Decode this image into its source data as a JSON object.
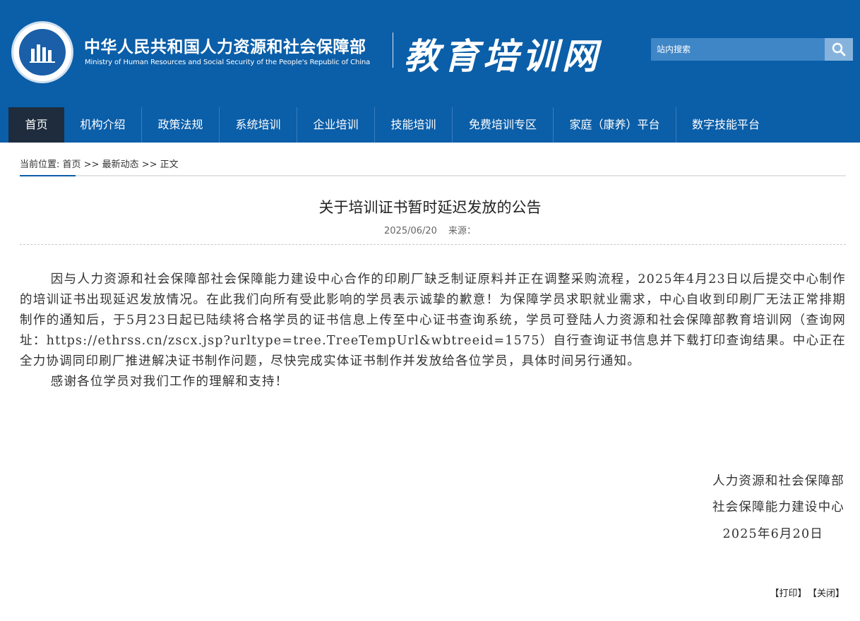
{
  "header": {
    "ministry_cn": "中华人民共和国人力资源和社会保障部",
    "ministry_en": "Ministry of Human Resources and Social Security of the People's Republic of China",
    "site_title": "教育培训网",
    "search_placeholder": "站内搜索",
    "logo_icon": "ministry-emblem-icon",
    "search_icon": "search-icon",
    "background_color": "#0b5ea8"
  },
  "nav": {
    "items": [
      {
        "label": "首页",
        "active": true
      },
      {
        "label": "机构介绍"
      },
      {
        "label": "政策法规"
      },
      {
        "label": "系统培训"
      },
      {
        "label": "企业培训"
      },
      {
        "label": "技能培训"
      },
      {
        "label": "免费培训专区"
      },
      {
        "label": "家庭（康养）平台"
      },
      {
        "label": "数字技能平台"
      }
    ]
  },
  "breadcrumb": {
    "prefix": "当前位置: ",
    "home": "首页",
    "sep1": " >> ",
    "section": "最新动态",
    "sep2": " >> ",
    "current": "正文"
  },
  "article": {
    "title": "关于培训证书暂时延迟发放的公告",
    "date": "2025/06/20",
    "source_label": "来源：",
    "paragraphs": [
      "因与人力资源和社会保障部社会保障能力建设中心合作的印刷厂缺乏制证原料并正在调整采购流程，2025年4月23日以后提交中心制作的培训证书出现延迟发放情况。在此我们向所有受此影响的学员表示诚挚的歉意！为保障学员求职就业需求，中心自收到印刷厂无法正常排期制作的通知后，于5月23日起已陆续将合格学员的证书信息上传至中心证书查询系统，学员可登陆人力资源和社会保障部教育培训网（查询网址：https://ethrss.cn/zscx.jsp?urltype=tree.TreeTempUrl&wbtreeid=1575）自行查询证书信息并下载打印查询结果。中心正在全力协调同印刷厂推进解决证书制作问题，尽快完成实体证书制作并发放给各位学员，具体时间另行通知。",
      "感谢各位学员对我们工作的理解和支持！"
    ],
    "signature": {
      "org1": "人力资源和社会保障部",
      "org2": "社会保障能力建设中心",
      "date": "2025年6月20日"
    }
  },
  "footer": {
    "print": "【打印】",
    "close": "【关闭】"
  }
}
